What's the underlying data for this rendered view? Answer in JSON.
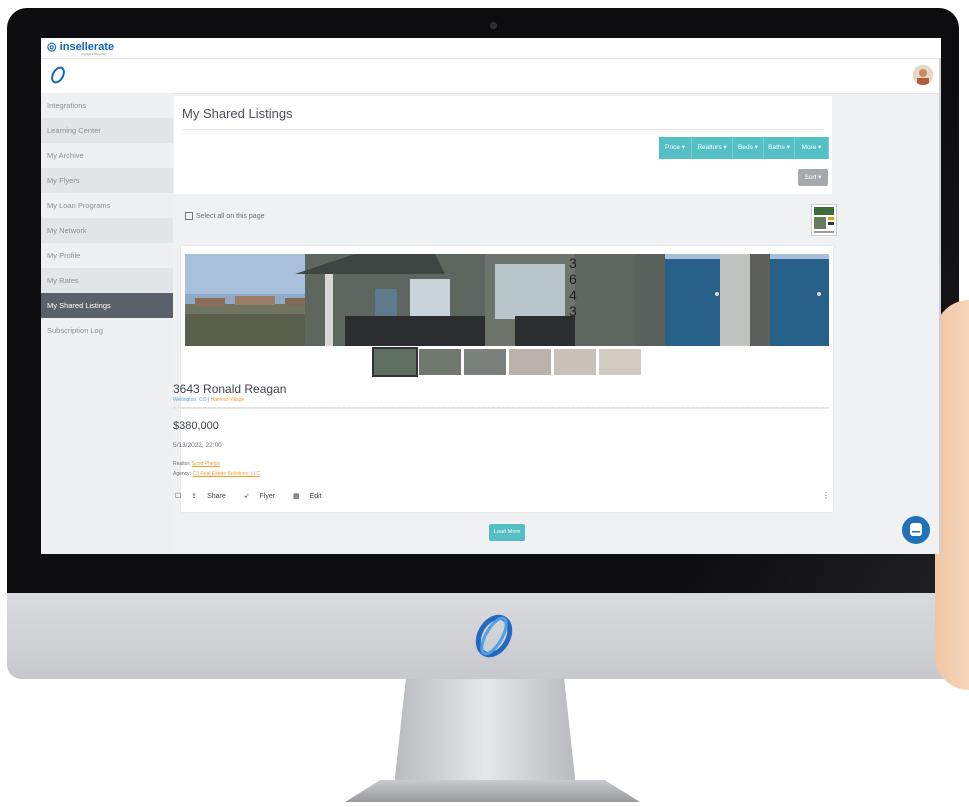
{
  "brand": {
    "name": "insellerate",
    "tagline": "engage intelligently"
  },
  "sidebar": {
    "items": [
      {
        "label": "Integrations"
      },
      {
        "label": "Learning Center"
      },
      {
        "label": "My Archive"
      },
      {
        "label": "My Flyers"
      },
      {
        "label": "My Loan Programs"
      },
      {
        "label": "My Network"
      },
      {
        "label": "My Profile"
      },
      {
        "label": "My Rates"
      },
      {
        "label": "My Shared Listings",
        "active": true
      },
      {
        "label": "Subscription Log"
      }
    ]
  },
  "main": {
    "title": "My Shared Listings",
    "filters": [
      "Price ▾",
      "Realtors ▾",
      "Beds ▾",
      "Baths ▾",
      "More ▾"
    ],
    "sort_label": "Sort ▾",
    "select_all_label": "Select all on this page",
    "listing": {
      "address": "3643 Ronald Reagan",
      "city": "Wellington, CO",
      "subdivision": "Harvest Village",
      "price": "$380,000",
      "date": "5/13/2022, 22:00",
      "realtor_label": "Realtor:",
      "realtor_name": "Scott Phelps",
      "agency_label": "Agency:",
      "agency_name": "C3 Real Estate Solutions, LLC",
      "actions": {
        "share": "Share",
        "flyer": "Flyer",
        "edit": "Edit"
      }
    },
    "load_more_label": "Load More"
  },
  "colors": {
    "accent": "#55bfc6",
    "active_nav": "#5b616a",
    "brand": "#1565c0",
    "link": "#f39c2f"
  }
}
